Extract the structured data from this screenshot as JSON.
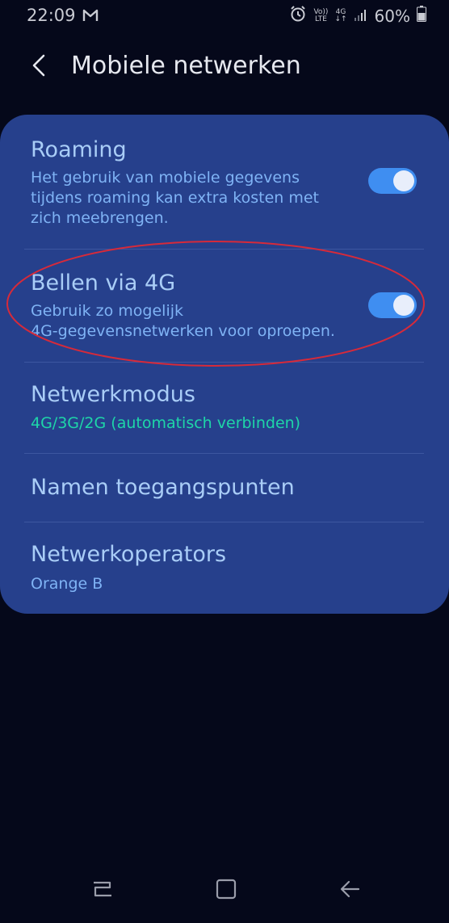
{
  "status_bar": {
    "time": "22:09",
    "volte_label": "Vo)) LTE",
    "volte_top": "Vo))",
    "volte_bottom": "LTE",
    "network_label": "4G",
    "battery": "60%"
  },
  "header": {
    "title": "Mobiele netwerken"
  },
  "settings": {
    "items": [
      {
        "title": "Roaming",
        "subtitle": "Het gebruik van mobiele gegevens\ntijdens roaming kan extra kosten met\nzich meebrengen.",
        "toggle_on": true
      },
      {
        "title": "Bellen via 4G",
        "subtitle": "Gebruik zo mogelijk\n4G-gegevensnetwerken voor oproepen.",
        "toggle_on": true
      },
      {
        "title": "Netwerkmodus",
        "subtitle": "4G/3G/2G (automatisch verbinden)"
      },
      {
        "title": "Namen toegangspunten"
      },
      {
        "title": "Netwerkoperators",
        "subtitle": "Orange B"
      }
    ]
  },
  "colors": {
    "background": "#05081a",
    "card": "#26408c",
    "title_text": "#a9cdf7",
    "subtitle_text": "#7fb3f5",
    "accent_text": "#1ed6a8",
    "toggle_track": "#3f8ef1",
    "annotation": "#d62a3a"
  },
  "icons": {
    "back": "chevron-left-icon",
    "gmail": "gmail-icon",
    "alarm": "alarm-icon",
    "signal": "signal-icon",
    "battery": "battery-icon",
    "nav_recent": "recent-apps-icon",
    "nav_home": "home-icon",
    "nav_back": "back-arrow-icon"
  }
}
